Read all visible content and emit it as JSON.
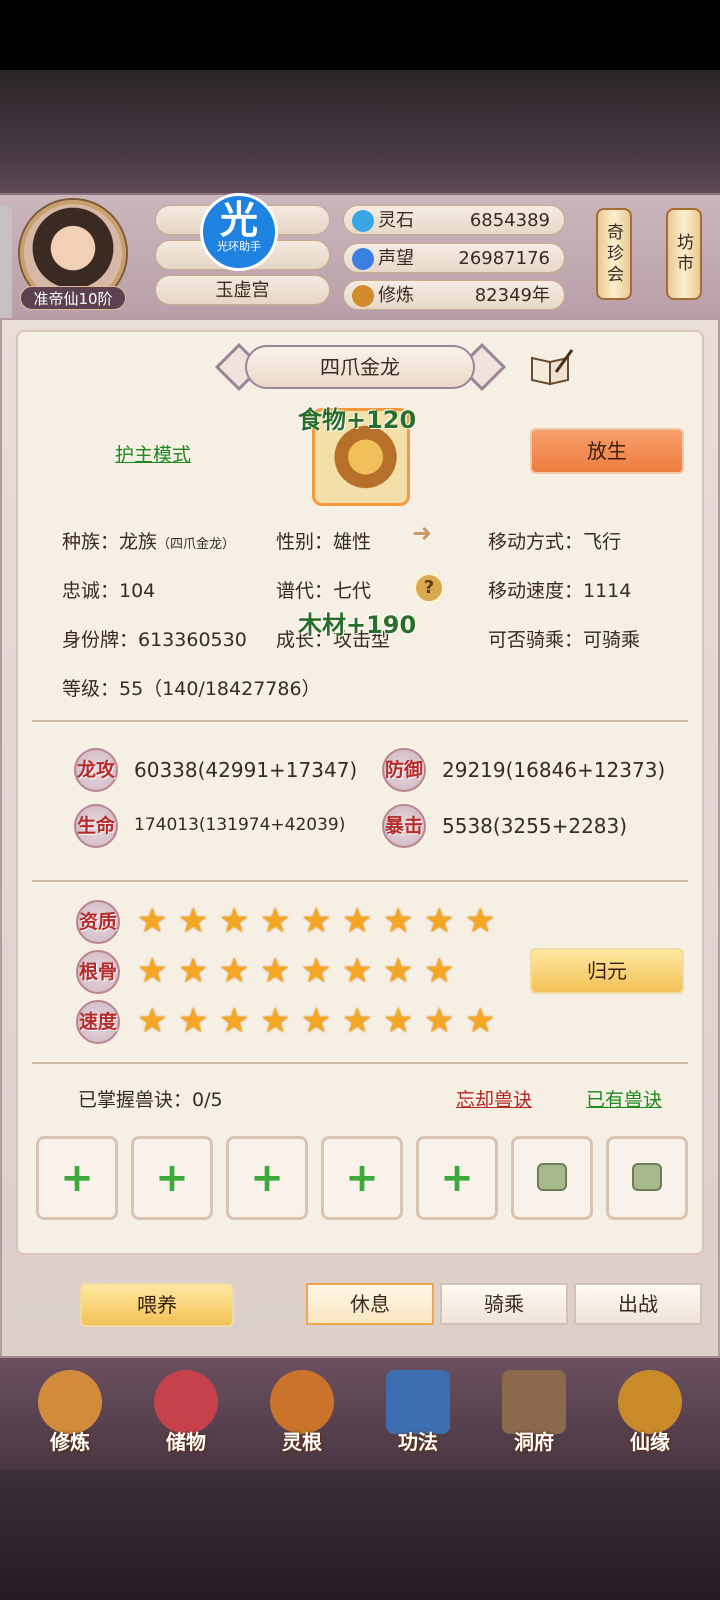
{
  "header": {
    "rank": "准帝仙10阶",
    "badge_big": "光",
    "badge_small": "光环助手",
    "sect": "玉虚宫",
    "resources": [
      {
        "label": "灵石",
        "value": "6854389",
        "icon": "spirit-stone-icon",
        "color": "#3aa6e6"
      },
      {
        "label": "声望",
        "value": "26987176",
        "icon": "prestige-icon",
        "color": "#3b7fe0"
      },
      {
        "label": "修炼",
        "value": "82349年",
        "icon": "meditation-icon",
        "color": "#d48b2e"
      }
    ],
    "lantern_left": "奇珍会",
    "lantern_right": "坊市"
  },
  "pet": {
    "name": "四爪金龙",
    "mode_link": "护主模式",
    "release_button": "放生",
    "float_food": "食物+120",
    "float_wood": "木材+190",
    "info": {
      "race_label": "种族：龙族",
      "race_sub": "（四爪金龙）",
      "gender": "性别：雄性",
      "move_type": "移动方式：飞行",
      "loyalty": "忠诚：104",
      "generation": "谱代：七代",
      "move_speed": "移动速度：1114",
      "id_tag": "身份牌：613360530",
      "growth": "成长：攻击型",
      "rideable": "可否骑乘：可骑乘",
      "level": "等级：55（140/18427786）"
    },
    "attrs": [
      {
        "badge": "龙攻",
        "value": "60338(42991+17347)"
      },
      {
        "badge": "防御",
        "value": "29219(16846+12373)"
      },
      {
        "badge": "生命",
        "value": "174013(131974+42039)"
      },
      {
        "badge": "暴击",
        "value": "5538(3255+2283)"
      }
    ],
    "ratings": [
      {
        "label": "资质",
        "stars": 9
      },
      {
        "label": "根骨",
        "stars": 8
      },
      {
        "label": "速度",
        "stars": 9
      }
    ],
    "return_button": "归元",
    "skills_mastered": "已掌握兽诀：0/5",
    "forget_link": "忘却兽诀",
    "owned_link": "已有兽诀",
    "skill_slots": [
      "+",
      "+",
      "+",
      "+",
      "+",
      "lock",
      "lock"
    ]
  },
  "actions": {
    "feed": "喂养",
    "tabs": [
      {
        "label": "休息",
        "active": true
      },
      {
        "label": "骑乘",
        "active": false
      },
      {
        "label": "出战",
        "active": false
      }
    ]
  },
  "nav": [
    {
      "label": "修炼",
      "icon": "cultivation-icon",
      "color": "#d28b3a"
    },
    {
      "label": "储物",
      "icon": "storage-bag-icon",
      "color": "#c7414b"
    },
    {
      "label": "灵根",
      "icon": "spirit-root-icon",
      "color": "#c9742a"
    },
    {
      "label": "功法",
      "icon": "technique-book-icon",
      "color": "#3d6fb0"
    },
    {
      "label": "洞府",
      "icon": "cave-mansion-icon",
      "color": "#8a6a4a"
    },
    {
      "label": "仙缘",
      "icon": "fate-gourd-icon",
      "color": "#c98a2a"
    }
  ]
}
